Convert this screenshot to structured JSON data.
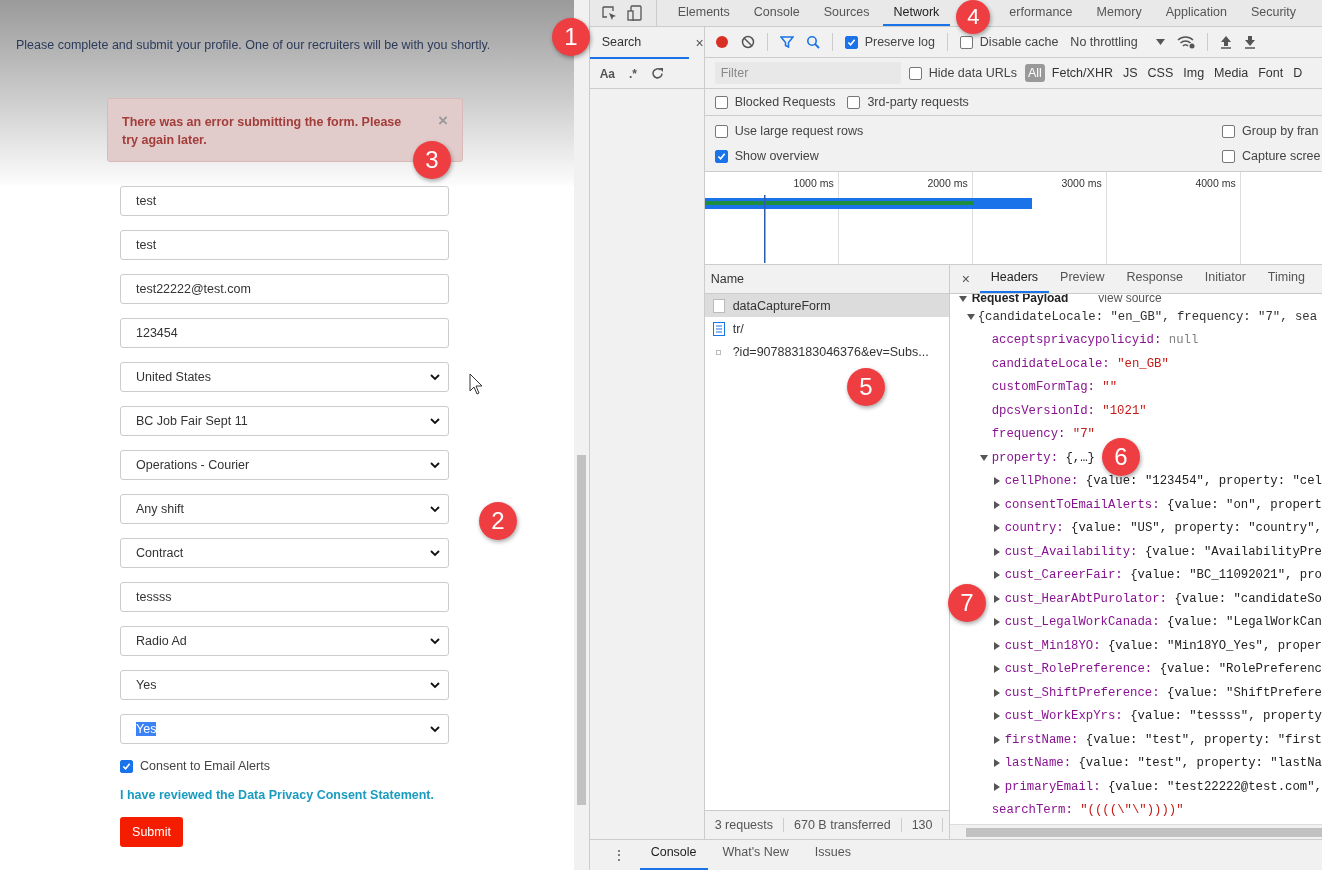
{
  "page": {
    "intro": "Please complete and submit your profile. One of our recruiters will be with you shortly.",
    "alert": {
      "message": "There was an error submitting the form. Please try again later.",
      "close": "×"
    },
    "fields": [
      {
        "kind": "input",
        "value": "test"
      },
      {
        "kind": "input",
        "value": "test"
      },
      {
        "kind": "input",
        "value": "test22222@test.com"
      },
      {
        "kind": "input",
        "value": "123454"
      },
      {
        "kind": "select",
        "value": "United States",
        "highlighted": false
      },
      {
        "kind": "select",
        "value": "BC Job Fair Sept 11",
        "highlighted": false
      },
      {
        "kind": "select",
        "value": "Operations - Courier",
        "highlighted": false
      },
      {
        "kind": "select",
        "value": "Any shift",
        "highlighted": false
      },
      {
        "kind": "select",
        "value": "Contract",
        "highlighted": false
      },
      {
        "kind": "input",
        "value": "tessss"
      },
      {
        "kind": "select",
        "value": "Radio Ad",
        "highlighted": false
      },
      {
        "kind": "select",
        "value": "Yes",
        "highlighted": false
      },
      {
        "kind": "select",
        "value": "Yes",
        "highlighted": true
      }
    ],
    "consent": {
      "label": "Consent to Email Alerts",
      "checked": true
    },
    "privacy_link": "I have reviewed the Data Privacy Consent Statement.",
    "submit": "Submit"
  },
  "devtools": {
    "tabs": [
      {
        "label": "Elements",
        "selected": false
      },
      {
        "label": "Console",
        "selected": false
      },
      {
        "label": "Sources",
        "selected": false
      },
      {
        "label": "Network",
        "selected": true
      },
      {
        "label": "erformance",
        "selected": false
      },
      {
        "label": "Memory",
        "selected": false
      },
      {
        "label": "Application",
        "selected": false
      },
      {
        "label": "Security",
        "selected": false
      }
    ],
    "search_pane": {
      "title": "Search",
      "close": "×",
      "case_toggle": "Aa",
      "regex_toggle": ".*"
    },
    "network": {
      "toolbar": {
        "preserve_log": {
          "label": "Preserve log",
          "checked": true
        },
        "disable_cache": {
          "label": "Disable cache",
          "checked": false
        },
        "throttling": "No throttling"
      },
      "filter": {
        "placeholder": "Filter",
        "hide_data_urls": {
          "label": "Hide data URLs",
          "checked": false
        },
        "types": [
          {
            "label": "All",
            "selected": true
          },
          {
            "label": "Fetch/XHR",
            "selected": false
          },
          {
            "label": "JS",
            "selected": false
          },
          {
            "label": "CSS",
            "selected": false
          },
          {
            "label": "Img",
            "selected": false
          },
          {
            "label": "Media",
            "selected": false
          },
          {
            "label": "Font",
            "selected": false
          },
          {
            "label": "D",
            "selected": false
          }
        ],
        "options": [
          {
            "label": "Blocked Requests",
            "checked": false
          },
          {
            "label": "3rd-party requests",
            "checked": false
          }
        ]
      },
      "settings": [
        {
          "label": "Use large request rows",
          "checked": false
        },
        {
          "label": "Group by fran",
          "checked": false
        },
        {
          "label": "Show overview",
          "checked": true
        },
        {
          "label": "Capture scree",
          "checked": false
        }
      ],
      "overview_ticks": [
        "1000 ms",
        "2000 ms",
        "3000 ms",
        "4000 ms"
      ],
      "name_header": "Name",
      "requests": [
        {
          "kind": "blank",
          "name": "dataCaptureForm",
          "selected": true
        },
        {
          "kind": "document",
          "name": "tr/",
          "selected": false
        },
        {
          "kind": "pixel",
          "name": "?id=907883183046376&ev=Subs...",
          "selected": false
        }
      ],
      "summary": [
        "3 requests",
        "670 B transferred",
        "130"
      ],
      "detail_close": "×",
      "detail_tabs": [
        {
          "label": "Headers",
          "selected": true
        },
        {
          "label": "Preview",
          "selected": false
        },
        {
          "label": "Response",
          "selected": false
        },
        {
          "label": "Initiator",
          "selected": false
        },
        {
          "label": "Timing",
          "selected": false
        }
      ],
      "payload": {
        "title": "Request Payload",
        "view_source": "view source",
        "root": {
          "summary": "{candidateLocale: \"en_GB\", frequency: \"7\", sea",
          "expanded": true,
          "children": [
            {
              "key": "acceptsprivacypolicyid:",
              "value": "null",
              "kind": "null"
            },
            {
              "key": "candidateLocale:",
              "value": "\"en_GB\"",
              "kind": "string"
            },
            {
              "key": "customFormTag:",
              "value": "\"\"",
              "kind": "string"
            },
            {
              "key": "dpcsVersionId:",
              "value": "\"1021\"",
              "kind": "string"
            },
            {
              "key": "frequency:",
              "value": "\"7\"",
              "kind": "string"
            },
            {
              "key": "property:",
              "value": "{,…}",
              "kind": "object",
              "expanded": true,
              "children": [
                {
                  "key": "cellPhone:",
                  "value": "{value: \"123454\", property: \"cel",
                  "kind": "object",
                  "expanded": false
                },
                {
                  "key": "consentToEmailAlerts:",
                  "value": "{value: \"on\", propert",
                  "kind": "object",
                  "expanded": false
                },
                {
                  "key": "country:",
                  "value": "{value: \"US\", property: \"country\",",
                  "kind": "object",
                  "expanded": false
                },
                {
                  "key": "cust_Availability:",
                  "value": "{value: \"AvailabilityPre",
                  "kind": "object",
                  "expanded": false
                },
                {
                  "key": "cust_CareerFair:",
                  "value": "{value: \"BC_11092021\", pro",
                  "kind": "object",
                  "expanded": false
                },
                {
                  "key": "cust_HearAbtPurolator:",
                  "value": "{value: \"candidateSo",
                  "kind": "object",
                  "expanded": false
                },
                {
                  "key": "cust_LegalWorkCanada:",
                  "value": "{value: \"LegalWorkCan",
                  "kind": "object",
                  "expanded": false
                },
                {
                  "key": "cust_Min18YO:",
                  "value": "{value: \"Min18YO_Yes\", proper",
                  "kind": "object",
                  "expanded": false
                },
                {
                  "key": "cust_RolePreference:",
                  "value": "{value: \"RolePreferenc",
                  "kind": "object",
                  "expanded": false
                },
                {
                  "key": "cust_ShiftPreference:",
                  "value": "{value: \"ShiftPrefere",
                  "kind": "object",
                  "expanded": false
                },
                {
                  "key": "cust_WorkExpYrs:",
                  "value": "{value: \"tessss\", property",
                  "kind": "object",
                  "expanded": false
                },
                {
                  "key": "firstName:",
                  "value": "{value: \"test\", property: \"first",
                  "kind": "object",
                  "expanded": false
                },
                {
                  "key": "lastName:",
                  "value": "{value: \"test\", property: \"lastNa",
                  "kind": "object",
                  "expanded": false
                },
                {
                  "key": "primaryEmail:",
                  "value": "{value: \"test22222@test.com\",",
                  "kind": "object",
                  "expanded": false
                }
              ]
            },
            {
              "key": "searchTerm:",
              "value": "\"((((\\\"\\\"))))\"",
              "kind": "string"
            }
          ]
        }
      },
      "drawer_tabs": [
        {
          "label": "Console",
          "selected": true
        },
        {
          "label": "What's New",
          "selected": false
        },
        {
          "label": "Issues",
          "selected": false
        }
      ],
      "drawer_menu": "⋮"
    }
  },
  "callouts": [
    "1",
    "2",
    "3",
    "4",
    "5",
    "6",
    "7"
  ]
}
